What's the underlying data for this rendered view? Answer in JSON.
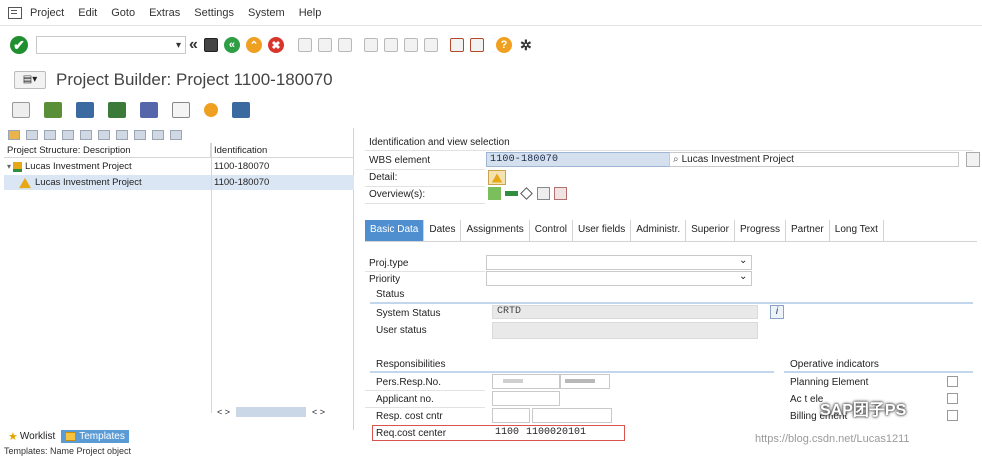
{
  "menu": {
    "items": [
      "Project",
      "Edit",
      "Goto",
      "Extras",
      "Settings",
      "System",
      "Help"
    ]
  },
  "toolbar": {
    "back_symbol": "«",
    "ok_symbol": "✔",
    "cancel_symbol": "✖",
    "help_symbol": "?"
  },
  "title": {
    "text": "Project Builder: Project 1100-180070"
  },
  "structure": {
    "col_desc": "Project Structure: Description",
    "col_id": "Identification",
    "rows": [
      {
        "desc": "Lucas Investment Project",
        "id": "1100-180070"
      },
      {
        "desc": "Lucas Investment Project",
        "id": "1100-180070"
      }
    ],
    "scroll_left": "< >",
    "scroll_right": "< >"
  },
  "lower_tabs": {
    "worklist": "Worklist",
    "templates": "Templates",
    "status_line": "Templates: Name Project object"
  },
  "id_section": {
    "title": "Identification and view selection",
    "wbs_label": "WBS element",
    "wbs_value": "1100-180070",
    "wbs_desc": "Lucas Investment Project",
    "detail_label": "Detail:",
    "overview_label": "Overview(s):"
  },
  "tabs": [
    "Basic Data",
    "Dates",
    "Assignments",
    "Control",
    "User fields",
    "Administr.",
    "Superior",
    "Progress",
    "Partner",
    "Long Text"
  ],
  "basic": {
    "proj_type_label": "Proj.type",
    "priority_label": "Priority",
    "status_title": "Status",
    "system_status_label": "System Status",
    "system_status_value": "CRTD",
    "user_status_label": "User status",
    "info_symbol": "i"
  },
  "responsibilities": {
    "title": "Responsibilities",
    "pers_resp_label": "Pers.Resp.No.",
    "applicant_label": "Applicant no.",
    "resp_cc_label": "Resp. cost cntr",
    "req_cc_label": "Req.cost center",
    "req_cc_co": "1100",
    "req_cc_value": "1100020101"
  },
  "operative": {
    "title": "Operative indicators",
    "planning_label": "Planning Element",
    "acct_label": "Ac   t ele",
    "billing_label": "Billing   ement"
  },
  "watermark": {
    "brand": "SAP团子PS",
    "url": "https://blog.csdn.net/Lucas1211"
  },
  "colors": {
    "accent": "#4f8fd0",
    "selection": "#dbe6f5",
    "warning": "#e6a817",
    "ok_green": "#1f8f2f"
  }
}
